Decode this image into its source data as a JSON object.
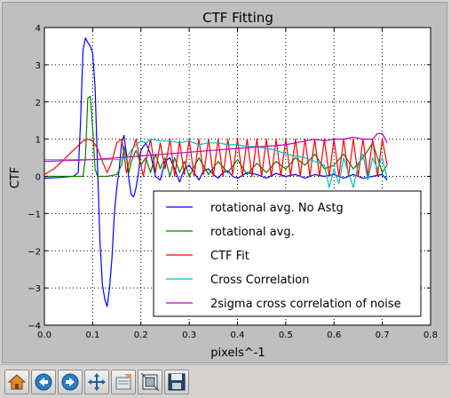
{
  "window": {
    "title": "CTF Fitting"
  },
  "toolbar": {
    "buttons": [
      {
        "name": "home-button",
        "icon": "home-icon"
      },
      {
        "name": "back-button",
        "icon": "arrow-left-icon"
      },
      {
        "name": "forward-button",
        "icon": "arrow-right-icon"
      },
      {
        "name": "pan-button",
        "icon": "move-icon"
      },
      {
        "name": "configure-button",
        "icon": "configure-icon"
      },
      {
        "name": "zoom-button",
        "icon": "zoom-rect-icon"
      },
      {
        "name": "save-button",
        "icon": "save-icon"
      }
    ]
  },
  "chart_data": {
    "type": "line",
    "title": "CTF Fitting",
    "xlabel": "pixels^-1",
    "ylabel": "CTF",
    "xlim": [
      0.0,
      0.8
    ],
    "ylim": [
      -4,
      4
    ],
    "xticks": [
      "0.0",
      "0.1",
      "0.2",
      "0.3",
      "0.4",
      "0.5",
      "0.6",
      "0.7",
      "0.8"
    ],
    "yticks": [
      "−4",
      "−3",
      "−2",
      "−1",
      "0",
      "1",
      "2",
      "3",
      "4"
    ],
    "grid": true,
    "legend": "lower-right",
    "series": [
      {
        "name": "rotational avg. No Astg",
        "color": "#0000ff",
        "x": [
          0.0,
          0.03,
          0.06,
          0.07,
          0.075,
          0.08,
          0.085,
          0.09,
          0.095,
          0.1,
          0.105,
          0.11,
          0.115,
          0.12,
          0.125,
          0.13,
          0.135,
          0.14,
          0.145,
          0.15,
          0.155,
          0.16,
          0.165,
          0.17,
          0.175,
          0.18,
          0.185,
          0.19,
          0.195,
          0.2,
          0.21,
          0.22,
          0.23,
          0.24,
          0.25,
          0.26,
          0.27,
          0.28,
          0.29,
          0.3,
          0.31,
          0.32,
          0.33,
          0.34,
          0.35,
          0.36,
          0.37,
          0.38,
          0.39,
          0.4,
          0.42,
          0.44,
          0.46,
          0.48,
          0.5,
          0.52,
          0.54,
          0.56,
          0.58,
          0.6,
          0.62,
          0.64,
          0.66,
          0.68,
          0.7,
          0.71
        ],
        "y": [
          -0.05,
          -0.03,
          0.0,
          0.1,
          1.5,
          3.4,
          3.72,
          3.6,
          3.5,
          3.3,
          2.4,
          0.3,
          -1.7,
          -2.9,
          -3.3,
          -3.5,
          -3.0,
          -2.2,
          -1.0,
          -0.3,
          0.2,
          0.9,
          1.1,
          0.6,
          -0.1,
          -0.5,
          -0.55,
          -0.3,
          0.1,
          0.7,
          0.9,
          0.6,
          0.0,
          -0.1,
          0.4,
          0.5,
          0.2,
          -0.15,
          0.2,
          0.3,
          0.1,
          -0.1,
          0.15,
          0.2,
          0.05,
          -0.05,
          0.1,
          0.15,
          0.0,
          -0.05,
          0.1,
          0.05,
          -0.05,
          0.08,
          0.0,
          0.05,
          -0.05,
          0.05,
          0.0,
          0.05,
          -0.05,
          0.05,
          -0.05,
          0.0,
          0.05,
          -0.1
        ]
      },
      {
        "name": "rotational avg.",
        "color": "#008000",
        "x": [
          0.0,
          0.03,
          0.06,
          0.08,
          0.085,
          0.09,
          0.095,
          0.1,
          0.105,
          0.11,
          0.13,
          0.15,
          0.16,
          0.165,
          0.17,
          0.175,
          0.18,
          0.19,
          0.2,
          0.21,
          0.22,
          0.23,
          0.24,
          0.25,
          0.26,
          0.27,
          0.28,
          0.29,
          0.3,
          0.32,
          0.34,
          0.36,
          0.38,
          0.4,
          0.42,
          0.44,
          0.46,
          0.48,
          0.5,
          0.52,
          0.54,
          0.56,
          0.58,
          0.6,
          0.62,
          0.64,
          0.66,
          0.68,
          0.7,
          0.71
        ],
        "y": [
          0.0,
          0.0,
          0.0,
          0.0,
          0.5,
          2.1,
          2.15,
          1.3,
          0.2,
          0.0,
          0.0,
          0.05,
          0.3,
          0.8,
          0.5,
          0.1,
          0.4,
          0.7,
          0.3,
          0.5,
          0.1,
          0.6,
          0.2,
          0.5,
          0.0,
          0.5,
          0.1,
          0.4,
          0.0,
          0.5,
          0.05,
          0.4,
          0.1,
          0.45,
          0.05,
          0.35,
          0.1,
          0.4,
          0.2,
          0.5,
          0.3,
          0.6,
          0.2,
          0.3,
          0.6,
          0.2,
          0.5,
          0.9,
          0.1,
          0.3
        ]
      },
      {
        "name": "CTF Fit",
        "color": "#ff0000",
        "x": [
          0.0,
          0.02,
          0.04,
          0.06,
          0.08,
          0.09,
          0.1,
          0.11,
          0.12,
          0.13,
          0.14,
          0.15,
          0.16,
          0.165,
          0.17,
          0.18,
          0.19,
          0.2,
          0.205,
          0.21,
          0.22,
          0.23,
          0.24,
          0.25,
          0.26,
          0.27,
          0.28,
          0.29,
          0.3,
          0.31,
          0.32,
          0.33,
          0.34,
          0.35,
          0.36,
          0.37,
          0.38,
          0.39,
          0.4,
          0.41,
          0.42,
          0.43,
          0.44,
          0.45,
          0.46,
          0.47,
          0.48,
          0.49,
          0.5,
          0.51,
          0.52,
          0.53,
          0.54,
          0.55,
          0.56,
          0.57,
          0.58,
          0.59,
          0.6,
          0.61,
          0.62,
          0.63,
          0.64,
          0.65,
          0.66,
          0.67,
          0.68,
          0.69,
          0.7,
          0.71
        ],
        "y": [
          0.05,
          0.2,
          0.45,
          0.7,
          0.95,
          1.0,
          0.95,
          0.75,
          0.4,
          0.1,
          0.4,
          0.9,
          1.0,
          0.6,
          0.1,
          0.6,
          1.0,
          0.3,
          0.0,
          0.4,
          1.0,
          0.1,
          0.9,
          0.2,
          1.0,
          0.0,
          0.95,
          0.05,
          1.0,
          0.0,
          1.0,
          0.05,
          1.0,
          0.0,
          1.0,
          0.0,
          1.0,
          0.05,
          1.0,
          0.0,
          1.0,
          0.0,
          1.0,
          0.0,
          1.0,
          0.0,
          1.0,
          0.0,
          1.0,
          0.0,
          1.0,
          0.0,
          1.0,
          0.0,
          1.0,
          0.0,
          1.0,
          0.0,
          1.0,
          0.0,
          1.0,
          0.0,
          1.0,
          0.0,
          1.0,
          0.0,
          1.0,
          0.0,
          1.0,
          0.3
        ]
      },
      {
        "name": "Cross Correlation",
        "color": "#00bfbf",
        "x": [
          0.0,
          0.1,
          0.16,
          0.17,
          0.18,
          0.19,
          0.2,
          0.21,
          0.22,
          0.24,
          0.26,
          0.28,
          0.3,
          0.32,
          0.34,
          0.36,
          0.38,
          0.4,
          0.42,
          0.44,
          0.46,
          0.48,
          0.5,
          0.52,
          0.54,
          0.56,
          0.58,
          0.59,
          0.6,
          0.61,
          0.62,
          0.63,
          0.64,
          0.65,
          0.66,
          0.67,
          0.68,
          0.69,
          0.7,
          0.71
        ],
        "y": [
          0.45,
          0.45,
          0.45,
          0.5,
          0.7,
          0.85,
          0.95,
          0.9,
          1.0,
          0.95,
          0.95,
          0.9,
          0.95,
          0.85,
          0.9,
          0.9,
          0.85,
          0.85,
          0.8,
          0.8,
          0.75,
          0.7,
          0.6,
          0.55,
          0.5,
          0.4,
          0.3,
          -0.3,
          0.2,
          -0.2,
          0.5,
          0.1,
          -0.3,
          0.3,
          0.6,
          -0.1,
          0.5,
          0.2,
          0.5,
          -0.05
        ]
      },
      {
        "name": "2sigma cross correlation of noise",
        "color": "#bf00bf",
        "x": [
          0.0,
          0.1,
          0.2,
          0.3,
          0.4,
          0.45,
          0.5,
          0.52,
          0.54,
          0.56,
          0.58,
          0.6,
          0.62,
          0.64,
          0.66,
          0.68,
          0.69,
          0.7,
          0.71
        ],
        "y": [
          0.4,
          0.45,
          0.55,
          0.65,
          0.75,
          0.8,
          0.85,
          0.9,
          0.95,
          1.0,
          0.95,
          1.0,
          1.0,
          1.05,
          1.0,
          1.0,
          1.15,
          1.15,
          0.9
        ]
      }
    ]
  }
}
